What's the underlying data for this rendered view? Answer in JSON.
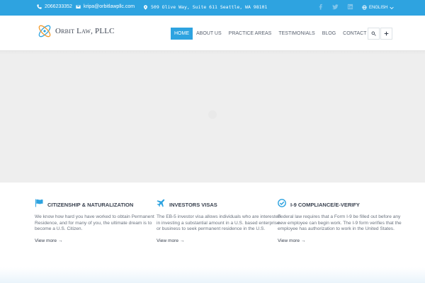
{
  "topbar": {
    "phone": "2066233352",
    "email": "kripa@orbitlawpllc.com",
    "address": "509 Olive Way, Suite 611 Seattle, WA 98101",
    "language": "ENGLISH"
  },
  "header": {
    "logo_text": "Orbit Law, PLLC",
    "nav": [
      {
        "label": "HOME"
      },
      {
        "label": "ABOUT US"
      },
      {
        "label": "PRACTICE AREAS"
      },
      {
        "label": "TESTIMONIALS"
      },
      {
        "label": "BLOG"
      },
      {
        "label": "CONTACT"
      }
    ]
  },
  "services": [
    {
      "icon": "flag-icon",
      "title": "Citizenship & Naturalization",
      "body": "We know how hard you have worked to obtain Permanent Residence, and for many of you, the ultimate dream is to become a U.S. Citizen.",
      "more": "View more →"
    },
    {
      "icon": "airplane-icon",
      "title": "Investors Visas",
      "body": "The EB-5 investor visa allows individuals who are interested in investing a substantial amount in a U.S. based enterprise or business to seek permanent residence in the U.S.",
      "more": "View more →"
    },
    {
      "icon": "check-circle-icon",
      "title": "I-9 Compliance/E-Verify",
      "body": "Federal law requires that a Form I-9 be filled out before any new employee can begin work. The I-9 form verifies that the employee has authorization to work in the United States.",
      "more": "View more →"
    }
  ],
  "colors": {
    "accent": "#2ea3e0",
    "text_dark": "#3a4250",
    "text_body": "#6a727e",
    "hero_bg": "#eeeeee"
  }
}
